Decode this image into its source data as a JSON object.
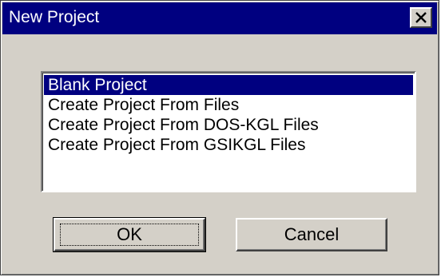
{
  "window": {
    "title": "New Project",
    "close_icon": "close-icon"
  },
  "project_types": {
    "selected_index": 0,
    "items": [
      {
        "label": "Blank Project"
      },
      {
        "label": "Create Project From Files"
      },
      {
        "label": "Create Project From DOS-KGL Files"
      },
      {
        "label": "Create Project From GSIKGL Files"
      }
    ]
  },
  "buttons": {
    "ok_label": "OK",
    "cancel_label": "Cancel"
  },
  "colors": {
    "titlebar": "#000080",
    "face": "#d4d0c8",
    "selection": "#000080"
  }
}
